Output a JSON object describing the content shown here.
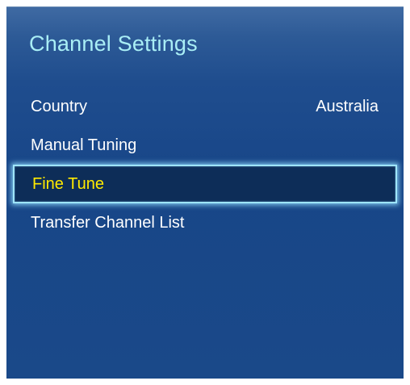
{
  "menu": {
    "title": "Channel Settings",
    "items": [
      {
        "label": "Country",
        "value": "Australia"
      },
      {
        "label": "Manual Tuning"
      },
      {
        "label": "Fine Tune"
      },
      {
        "label": "Transfer Channel List"
      }
    ],
    "selected_index": 2
  },
  "colors": {
    "title": "#a9eef5",
    "selected_text": "#ffea00",
    "panel": "#1f4d8e",
    "selected_bg": "#0d2d58",
    "focus_border": "#9fe5ff"
  }
}
